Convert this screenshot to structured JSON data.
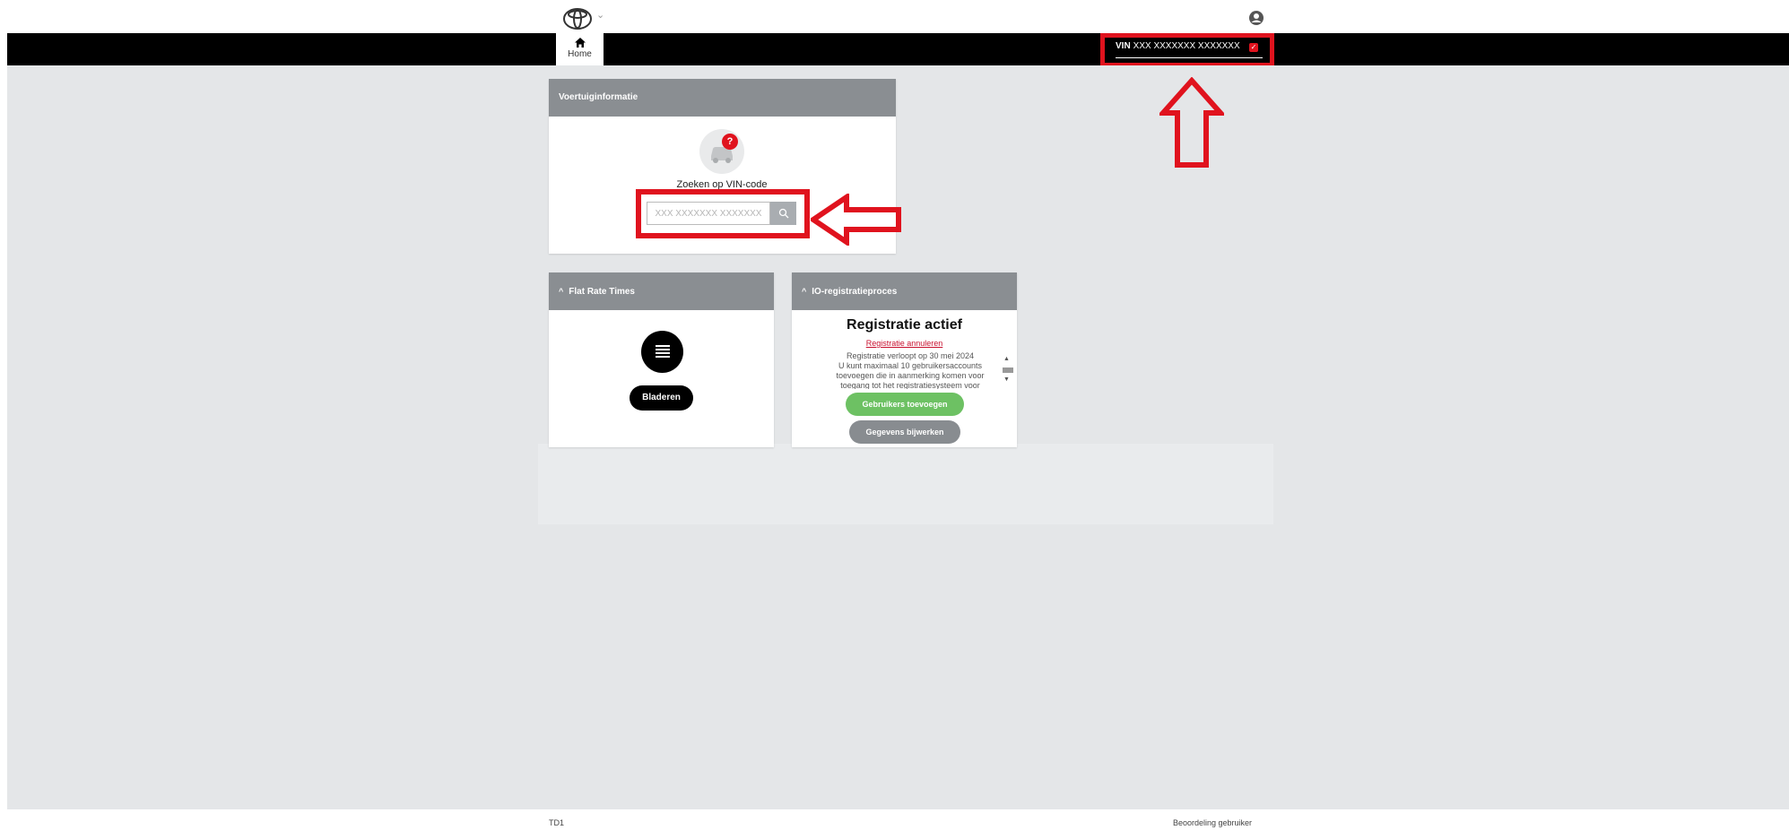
{
  "header": {
    "logo_icon": "toyota-logo-icon",
    "logo_dropdown_icon": "chevron-down-icon",
    "logo_dropdown_glyph": "⌄",
    "user_icon": "user-account-icon"
  },
  "nav": {
    "tabs": [
      {
        "label": "Home",
        "icon": "home-icon",
        "active": true
      }
    ],
    "vin": {
      "prefix": "VIN",
      "value": "XXX XXXXXXX XXXXXXX",
      "check_icon": "check-icon",
      "check_glyph": "✓"
    }
  },
  "vehicle_card": {
    "title": "Voertuiginformatie",
    "car_icon": "car-unknown-icon",
    "question_badge": "?",
    "search_label": "Zoeken op VIN-code",
    "search_placeholder": "XXX XXXXXXX XXXXXXX",
    "search_icon": "search-icon"
  },
  "flat_rate_card": {
    "caret": "^",
    "title": "Flat Rate Times",
    "list_icon": "list-icon",
    "browse_label": "Bladeren"
  },
  "registration_card": {
    "caret": "^",
    "title": "IO-registratieproces",
    "status_heading": "Registratie actief",
    "cancel_link": "Registratie annuleren",
    "body_lines": [
      "Registratie verloopt op 30 mei 2024",
      "U kunt maximaal 10 gebruikersaccounts",
      "toevoegen die in aanmerking komen voor",
      "toegang tot het registratiesysteem voor"
    ],
    "scroll_up_glyph": "▲",
    "scroll_down_glyph": "▼",
    "add_users_label": "Gebruikers toevoegen",
    "update_label": "Gegevens bijwerken"
  },
  "annotations": {
    "color": "#e0131e"
  },
  "colors": {
    "nav_bar": "#000000",
    "content_bg": "#e4e6e8",
    "card_header": "#8a8e92",
    "success_button": "#6dc163",
    "secondary_button": "#888c90",
    "brand_red": "#e0131e"
  },
  "footer": {
    "left": "TD1",
    "right": "Beoordeling gebruiker"
  }
}
